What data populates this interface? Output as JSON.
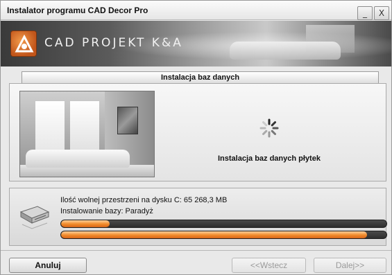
{
  "window": {
    "title": "Instalator programu CAD Decor Pro",
    "minimize_label": "_",
    "close_label": "X"
  },
  "banner": {
    "brand": "CAD PROJEKT K&A"
  },
  "section": {
    "title": "Instalacja baz danych"
  },
  "content": {
    "status_text": "Instalacja baz danych płytek",
    "spinner_icon": "loading-spinner-icon",
    "image_icon": "bathroom-photo"
  },
  "progress": {
    "free_space": "Ilość wolnej przestrzeni na dysku C: 65 268,3 MB",
    "installing": "Instalowanie bazy: Paradyż",
    "bar1_fraction": 0.15,
    "bar2_fraction": 0.94,
    "disk_icon": "hard-disk-icon",
    "fill_color": "#f08a2a",
    "track_color": "#3a3a3a"
  },
  "buttons": {
    "cancel": "Anuluj",
    "back": "<<Wstecz",
    "next": "Dalej>>"
  }
}
